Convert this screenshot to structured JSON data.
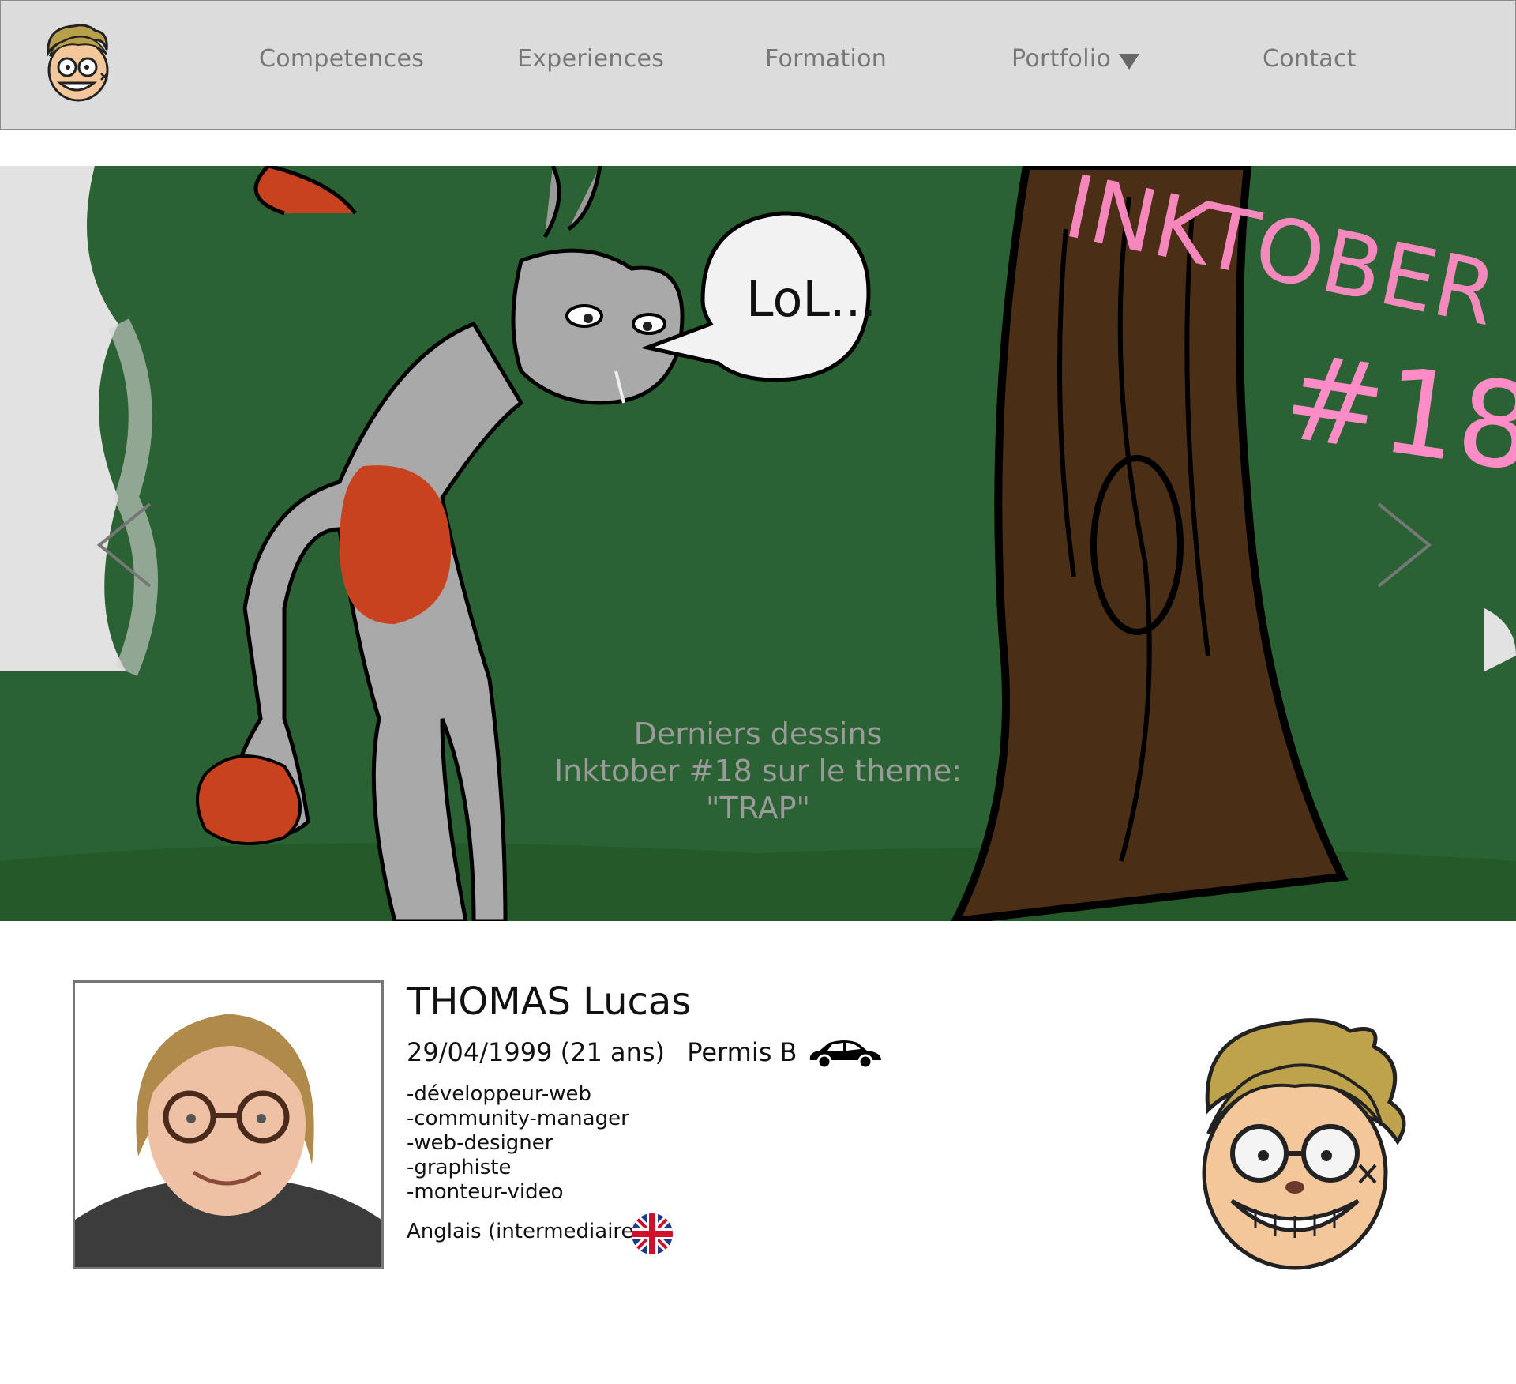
{
  "nav": {
    "logo": "avatar-logo",
    "items": [
      {
        "label": "Competences"
      },
      {
        "label": "Experiences"
      },
      {
        "label": "Formation"
      },
      {
        "label": "Portfolio",
        "has_dropdown": true
      },
      {
        "label": "Contact"
      }
    ]
  },
  "carousel": {
    "caption_line1": "Derniers dessins",
    "caption_line2": "Inktober #18 sur le theme:",
    "caption_line3": "\"TRAP\"",
    "speech_bubble": "LoL...",
    "neon_text": "Inktober #18",
    "prev_icon": "chevron-left-icon",
    "next_icon": "chevron-right-icon"
  },
  "profile": {
    "name": "THOMAS Lucas",
    "birthdate": "29/04/1999 (21 ans)",
    "license": "Permis B",
    "roles": [
      "-développeur-web",
      "-community-manager",
      "-web-designer",
      "-graphiste",
      "-monteur-video"
    ],
    "language": "Anglais (intermediaire)",
    "icons": [
      "car-icon",
      "uk-flag-icon"
    ]
  },
  "colors": {
    "nav_bg": "#dcdcdc",
    "nav_text": "#777777",
    "forest_green": "#2b6233",
    "neon_pink": "#ff4fa3",
    "bunny_orange": "#c9421f"
  }
}
